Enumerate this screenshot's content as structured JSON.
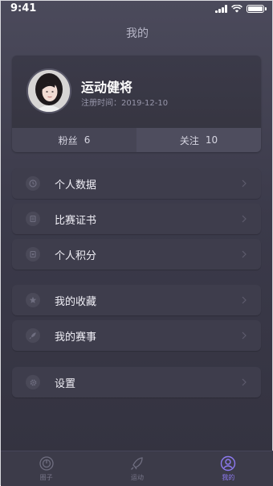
{
  "status_bar": {
    "time": "9:41"
  },
  "header": {
    "title": "我的"
  },
  "profile": {
    "name": "运动健将",
    "register_label": "注册时间：2019-12-10",
    "stats": [
      {
        "label": "粉丝",
        "value": "6"
      },
      {
        "label": "关注",
        "value": "10"
      }
    ]
  },
  "menu": [
    {
      "label": "个人数据",
      "icon": "clock-icon"
    },
    {
      "label": "比赛证书",
      "icon": "certificate-icon"
    },
    {
      "label": "个人积分",
      "icon": "points-icon"
    },
    {
      "label": "我的收藏",
      "icon": "star-icon"
    },
    {
      "label": "我的赛事",
      "icon": "rocket-icon"
    },
    {
      "label": "设置",
      "icon": "gear-icon"
    }
  ],
  "tabbar": {
    "tabs": [
      {
        "label": "圈子",
        "icon": "circle-icon",
        "active": false
      },
      {
        "label": "运动",
        "icon": "sport-icon",
        "active": false
      },
      {
        "label": "我的",
        "icon": "profile-icon",
        "active": true
      }
    ]
  },
  "colors": {
    "background": "#3b3a4a",
    "accent": "#8d7af0",
    "card": "#3e3d4c"
  }
}
